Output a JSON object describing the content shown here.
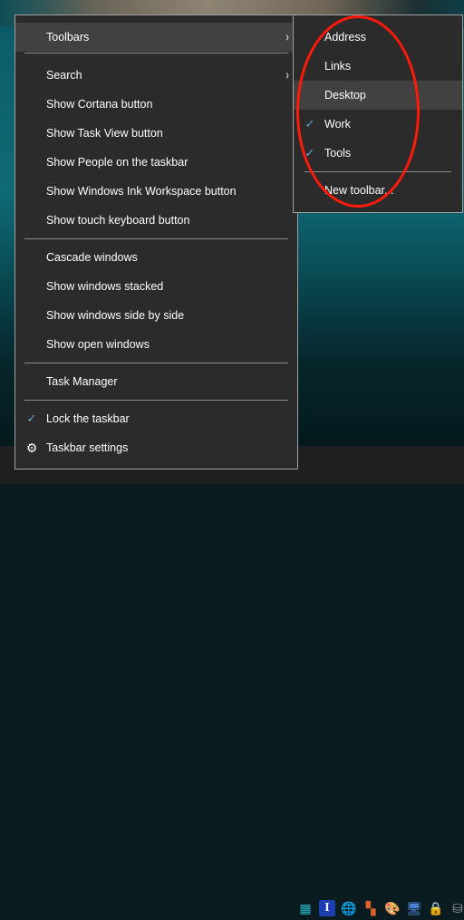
{
  "context_menu": {
    "items": [
      {
        "label": "Toolbars",
        "has_submenu": true,
        "highlighted": true
      },
      {
        "type": "separator"
      },
      {
        "label": "Search",
        "has_submenu": true
      },
      {
        "label": "Show Cortana button"
      },
      {
        "label": "Show Task View button"
      },
      {
        "label": "Show People on the taskbar"
      },
      {
        "label": "Show Windows Ink Workspace button"
      },
      {
        "label": "Show touch keyboard button"
      },
      {
        "type": "separator"
      },
      {
        "label": "Cascade windows"
      },
      {
        "label": "Show windows stacked"
      },
      {
        "label": "Show windows side by side"
      },
      {
        "label": "Show open windows"
      },
      {
        "type": "separator"
      },
      {
        "label": "Task Manager"
      },
      {
        "type": "separator"
      },
      {
        "label": "Lock the taskbar",
        "checked": true
      },
      {
        "label": "Taskbar settings",
        "icon": "gear-icon"
      }
    ],
    "submenu_arrow_glyph": "›",
    "check_glyph": "✓",
    "gear_glyph": "⚙"
  },
  "toolbars_submenu": {
    "items": [
      {
        "label": "Address",
        "checked": false
      },
      {
        "label": "Links",
        "checked": false
      },
      {
        "label": "Desktop",
        "checked": false,
        "highlighted": true
      },
      {
        "label": "Work",
        "checked": true
      },
      {
        "label": "Tools",
        "checked": true
      },
      {
        "type": "separator"
      },
      {
        "label": "New toolbar..."
      }
    ]
  },
  "annotation": {
    "shape": "ellipse",
    "color": "#ff1a0a",
    "encloses": "toolbars_submenu"
  },
  "tray_icons": [
    {
      "name": "server-icon",
      "glyph": "▦",
      "color": "#2ab6c8"
    },
    {
      "name": "text-tool-icon",
      "glyph": "I",
      "color": "#ffffff",
      "bg": "#1b3fb0"
    },
    {
      "name": "network-globe-icon",
      "glyph": "🌐",
      "color": "#3a9be0"
    },
    {
      "name": "app-tiles-icon",
      "glyph": "▚",
      "color": "#e0602a"
    },
    {
      "name": "paint-palette-icon",
      "glyph": "🎨",
      "color": "#e0e0e0"
    },
    {
      "name": "remote-desktop-icon",
      "glyph": "🖥",
      "color": "#4a7fd0"
    },
    {
      "name": "secure-notes-icon",
      "glyph": "🔒",
      "color": "#f0e040"
    },
    {
      "name": "disk-drive-icon",
      "glyph": "⛁",
      "color": "#9a9a9a"
    }
  ],
  "colors": {
    "menu_bg": "#2b2b2b",
    "menu_hover": "#414141",
    "menu_border": "#a0a0a0",
    "check_accent": "#62a8d8",
    "text": "#ffffff"
  }
}
